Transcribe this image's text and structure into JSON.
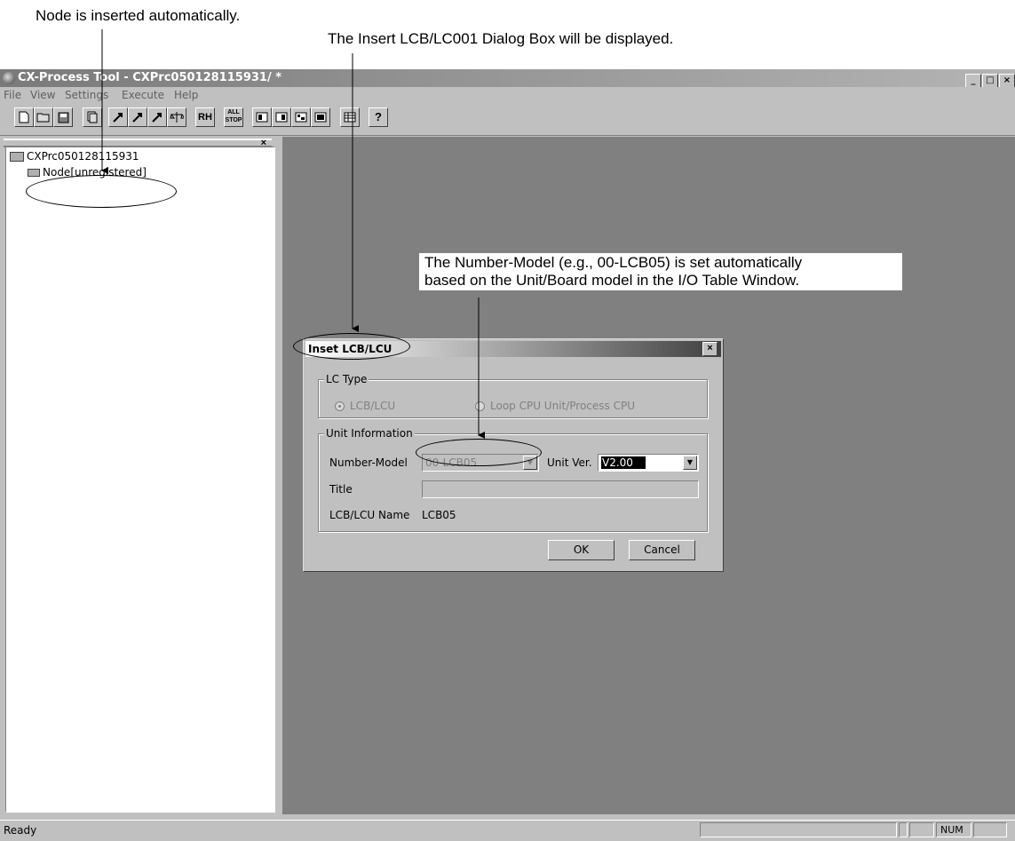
{
  "annotations": {
    "node_inserted": "Node is inserted automatically.",
    "dialog_displayed": "The Insert LCB/LC001 Dialog Box will be displayed.",
    "number_model_line1": "The Number-Model (e.g., 00-LCB05) is set automatically",
    "number_model_line2": "based on the Unit/Board model in the I/O Table Window."
  },
  "window": {
    "title": "CX-Process Tool - CXPrc050128115931/ *",
    "controls": [
      "_",
      "□",
      "×"
    ]
  },
  "menu": [
    "File",
    "View",
    "Settings",
    "Execute",
    "Help"
  ],
  "toolbar": {
    "icons": [
      "new-icon",
      "open-icon",
      "save-icon",
      "copy-icon",
      "transfer-up-icon",
      "transfer-icon",
      "transfer-down-icon",
      "compare-icon",
      "run-icon",
      "stop-icon",
      "block-icon-1",
      "block-icon-2",
      "block-icon-3",
      "block-icon-4",
      "table-icon",
      "help-icon"
    ],
    "labels": {
      "run": "RH",
      "stop": "ALL STOP",
      "help": "?"
    }
  },
  "tree": {
    "close": "×",
    "root": "CXPrc050128115931",
    "node": "Node[unregistered]"
  },
  "status": {
    "text": "Ready",
    "num": "NUM"
  },
  "dialog": {
    "title": "Inset LCB/LCU",
    "close": "×",
    "lc_type": {
      "label": "LC Type",
      "option1": "LCB/LCU",
      "option2": "Loop CPU Unit/Process CPU"
    },
    "unit_info": {
      "label": "Unit Information",
      "number_model_label": "Number-Model",
      "number_model_value": "00-LCB05",
      "unit_ver_label": "Unit Ver.",
      "unit_ver_value": "V2.00",
      "title_label": "Title",
      "name_label": "LCB/LCU Name",
      "name_value": "LCB05"
    },
    "ok": "OK",
    "cancel": "Cancel"
  }
}
